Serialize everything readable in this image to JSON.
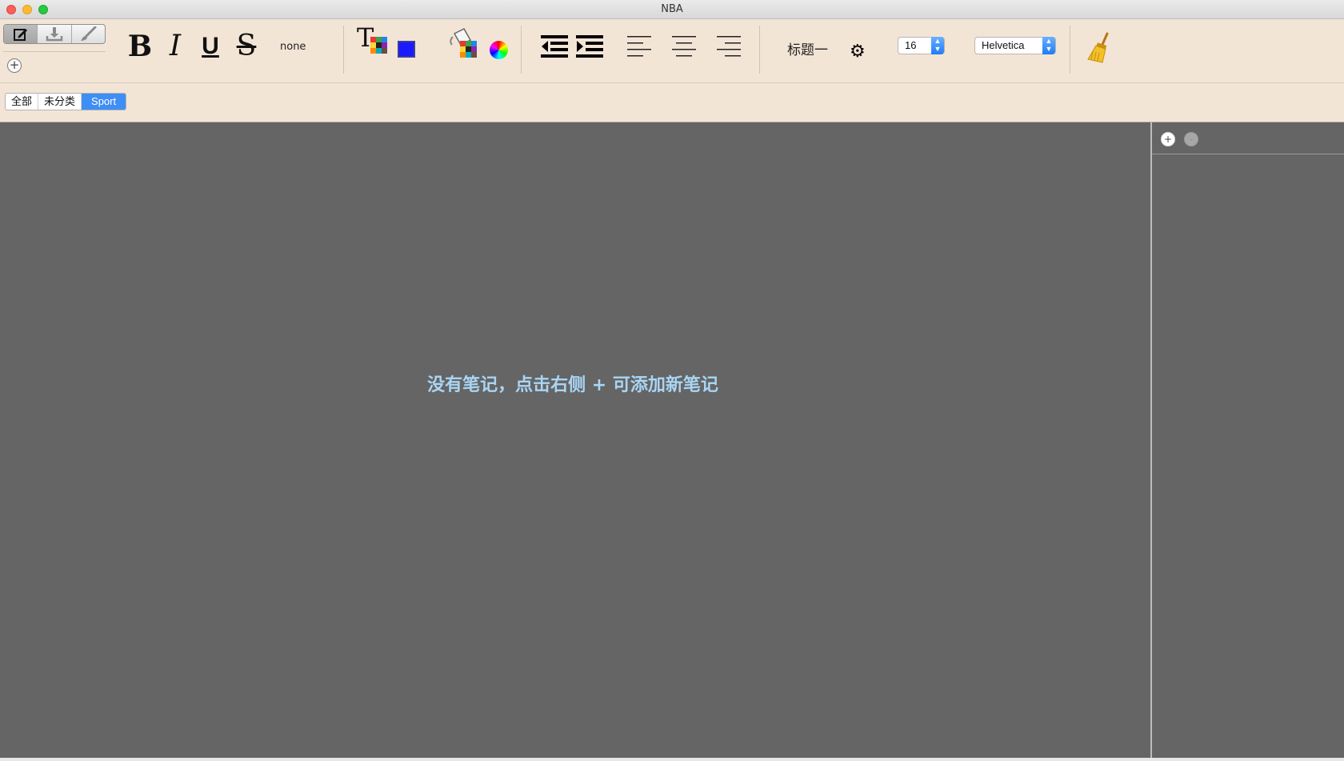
{
  "window": {
    "title": "NBA"
  },
  "toolbar": {
    "edit_mode_icon": "edit-icon",
    "download_icon": "download-icon",
    "brush_icon": "brush-icon",
    "add_icon": "plus-icon",
    "bold": "B",
    "italic": "I",
    "underline": "U",
    "strikethrough": "S",
    "style_value": "none",
    "text_color_letter": "T",
    "text_color": "#1a1aff",
    "heading": "标题一",
    "font_size": "16",
    "font_family": "Helvetica"
  },
  "categories": {
    "tabs": [
      "全部",
      "未分类",
      "Sport"
    ],
    "selected": "Sport"
  },
  "main": {
    "empty_message": "没有笔记，点击右侧 + 可添加新笔记"
  },
  "side_panel": {
    "add_label": "+",
    "remove_label": "-"
  }
}
